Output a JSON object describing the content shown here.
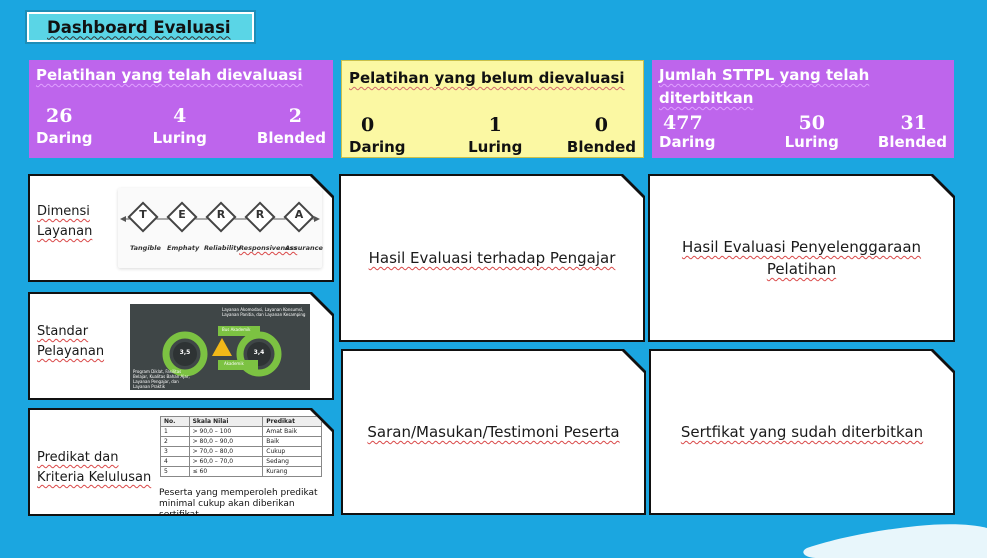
{
  "header": {
    "title": "Dashboard Evaluasi"
  },
  "stats": {
    "evaluated": {
      "title": "Pelatihan yang telah dievaluasi",
      "items": [
        {
          "value": "26",
          "label": "Daring"
        },
        {
          "value": "4",
          "label": "Luring"
        },
        {
          "value": "2",
          "label": "Blended"
        }
      ]
    },
    "not_evaluated": {
      "title": "Pelatihan yang belum dievaluasi",
      "items": [
        {
          "value": "0",
          "label": "Daring"
        },
        {
          "value": "1",
          "label": "Luring"
        },
        {
          "value": "0",
          "label": "Blended"
        }
      ]
    },
    "sttpl": {
      "title": "Jumlah STTPL yang telah diterbitkan",
      "items": [
        {
          "value": "477",
          "label": "Daring"
        },
        {
          "value": "50",
          "label": "Luring"
        },
        {
          "value": "31",
          "label": "Blended"
        }
      ]
    }
  },
  "left_cards": {
    "dimensi": {
      "label_line1": "Dimensi",
      "label_line2": "Layanan",
      "letters": [
        "T",
        "E",
        "R",
        "R",
        "A"
      ],
      "dims": [
        "Tangible",
        "Emphaty",
        "Reliability",
        "Responsiveness",
        "Assurance"
      ]
    },
    "standar": {
      "label_line1": "Standar",
      "label_line2": "Pelayanan",
      "gauge_a": "3,5",
      "gauge_b": "3,4",
      "tag_a": "Bus Akademik",
      "tag_b": "Akademik",
      "text_top": "Layanan Akomodasi, Layanan Konsumsi, Layanan Panitia, dan Layanan Kesamping",
      "text_bottom": "Program Diklat, Fasilitas Belajar, Kualitas Bahan Ajar, Layanan Pengajar, dan Layanan Praktik"
    },
    "predikat": {
      "label_line1": "Predikat dan",
      "label_line2": "Kriteria Kelulusan",
      "table_headers": [
        "No.",
        "Skala Nilai",
        "Predikat"
      ],
      "table_rows": [
        [
          "1",
          "> 90,0 – 100",
          "Amat Baik"
        ],
        [
          "2",
          "> 80,0 – 90,0",
          "Baik"
        ],
        [
          "3",
          "> 70,0 – 80,0",
          "Cukup"
        ],
        [
          "4",
          "> 60,0 – 70,0",
          "Sedang"
        ],
        [
          "5",
          "≤ 60",
          "Kurang"
        ]
      ],
      "note": "Peserta yang memperoleh predikat minimal cukup akan diberikan sertifikat"
    }
  },
  "cards": {
    "pengajar": "Hasil Evaluasi terhadap Pengajar",
    "penyelenggaraan": "Hasil Evaluasi Penyelenggaraan Pelatihan",
    "saran": "Saran/Masukan/Testimoni Peserta",
    "sertifikat": "Sertfikat yang sudah diterbitkan"
  },
  "colors": {
    "background": "#1ba6e0",
    "title_tab": "#5ad5e6",
    "stat_purple": "#be65ec",
    "stat_yellow": "#fbf8a3",
    "card": "#ffffff"
  }
}
